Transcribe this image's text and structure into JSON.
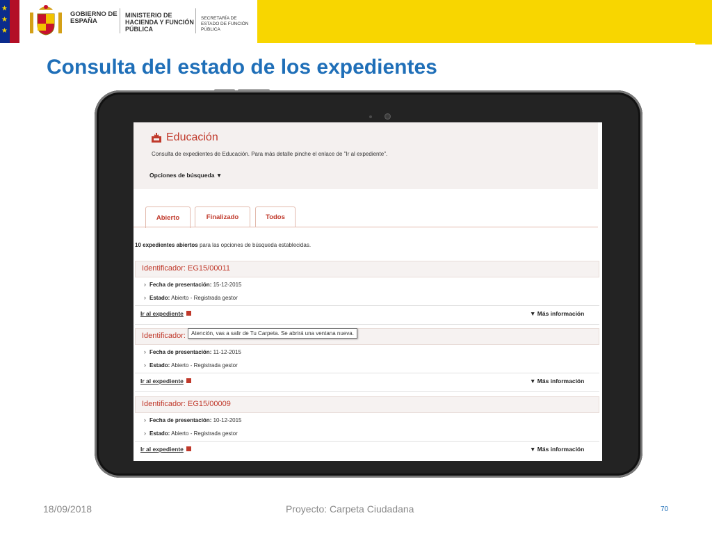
{
  "banner": {
    "gobierno": "GOBIERNO DE ESPAÑA",
    "ministerio": "MINISTERIO DE HACIENDA Y FUNCIÓN PÚBLICA",
    "secretaria": "SECRETARÍA DE ESTADO DE FUNCIÓN PÚBLICA",
    "brand_yellow": "#f8d600"
  },
  "page_title": "Consulta del estado de los expedientes",
  "app": {
    "title": "Educación",
    "description": "Consulta de expedientes de Educación. Para más detalle pinche el enlace de \"Ir al expediente\".",
    "search_options": "Opciones de búsqueda ▼",
    "tabs": [
      {
        "label": "Abierto",
        "active": true
      },
      {
        "label": "Finalizado",
        "active": false
      },
      {
        "label": "Todos",
        "active": false
      }
    ],
    "results_count": "10 expedientes abiertos",
    "results_rest": " para las opciones de búsqueda establecidas.",
    "records": [
      {
        "id": "Identificador: EG15/00011",
        "date_label": "Fecha de presentación:",
        "date_value": " 15-12-2015",
        "status_label": "Estado:",
        "status_value": " Abierto - Registrada gestor",
        "link": "Ir al expediente",
        "more": "▼ Más información"
      },
      {
        "id": "Identificador:",
        "date_label": "Fecha de presentación:",
        "date_value": " 11-12-2015",
        "status_label": "Estado:",
        "status_value": " Abierto - Registrada gestor",
        "link": "Ir al expediente",
        "more": "▼ Más información"
      },
      {
        "id": "Identificador: EG15/00009",
        "date_label": "Fecha de presentación:",
        "date_value": " 10-12-2015",
        "status_label": "Estado:",
        "status_value": " Abierto - Registrada gestor",
        "link": "Ir al expediente",
        "more": "▼ Más información"
      }
    ],
    "tooltip": "Atención, vas a salir de Tu Carpeta. Se abrirá una ventana nueva.",
    "accent_color": "#c0392b"
  },
  "footer": {
    "date": "18/09/2018",
    "project": "Proyecto: Carpeta Ciudadana",
    "page": "70"
  }
}
